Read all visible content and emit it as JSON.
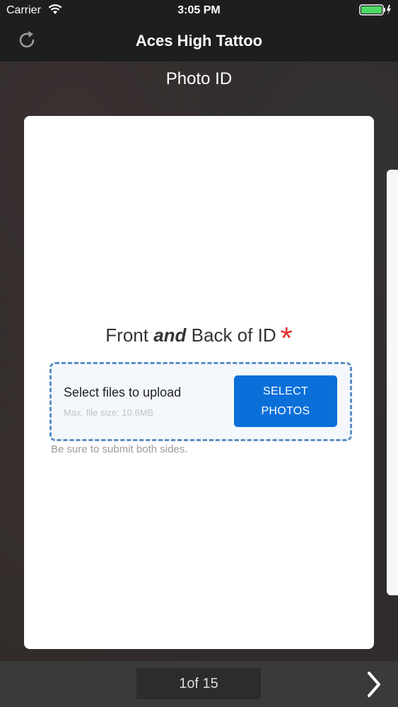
{
  "status_bar": {
    "carrier": "Carrier",
    "time": "3:05 PM"
  },
  "header": {
    "title": "Aces High Tattoo",
    "refresh_icon": "refresh-icon"
  },
  "page": {
    "title": "Photo ID"
  },
  "form": {
    "field_label_part1": "Front ",
    "field_label_emphasis": "and",
    "field_label_part2": " Back of ID",
    "required_mark": "*",
    "upload_title": "Select files to upload",
    "upload_hint": "Max. file size: 10.6MB",
    "select_button_line1": "SELECT",
    "select_button_line2": "PHOTOS",
    "help_text": "Be sure to submit both sides."
  },
  "footer": {
    "pager_current": "1",
    "pager_of": " of 15",
    "next_icon": "chevron-right-icon"
  },
  "colors": {
    "accent": "#0b6fd9",
    "required": "#e0322d",
    "dashed_border": "#5b8fc4"
  }
}
